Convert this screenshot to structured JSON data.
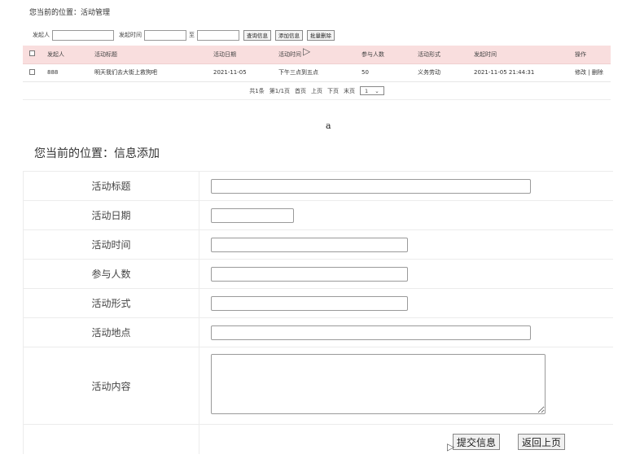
{
  "panel_a": {
    "breadcrumb": "您当前的位置：活动管理",
    "toolbar": {
      "initiator_label": "发起人",
      "time_label": "发起时间",
      "to_label": "至",
      "query_button": "查询信息",
      "add_button": "添加信息",
      "batch_delete_button": "批量删除"
    },
    "table": {
      "headers": [
        "发起人",
        "活动标题",
        "活动日期",
        "活动时间",
        "参与人数",
        "活动形式",
        "发起时间",
        "操作"
      ],
      "rows": [
        {
          "initiator": "888",
          "title": "明天我们去大街上救狗吧",
          "date": "2021-11-05",
          "time": "下午三点到五点",
          "participants": "50",
          "form": "义务劳动",
          "created": "2021-11-05 21:44:31",
          "edit": "修改",
          "sep": "|",
          "delete": "删除"
        }
      ]
    },
    "pager": {
      "total": "共1条",
      "page": "第1/1页",
      "first": "首页",
      "prev": "上页",
      "next": "下页",
      "last": "末页",
      "select_value": "1"
    }
  },
  "caption": "a",
  "panel_b": {
    "breadcrumb": "您当前的位置：信息添加",
    "fields": {
      "title": "活动标题",
      "date": "活动日期",
      "time": "活动时间",
      "participants": "参与人数",
      "form": "活动形式",
      "location": "活动地点",
      "content": "活动内容"
    },
    "submit_button": "提交信息",
    "back_button": "返回上页"
  }
}
